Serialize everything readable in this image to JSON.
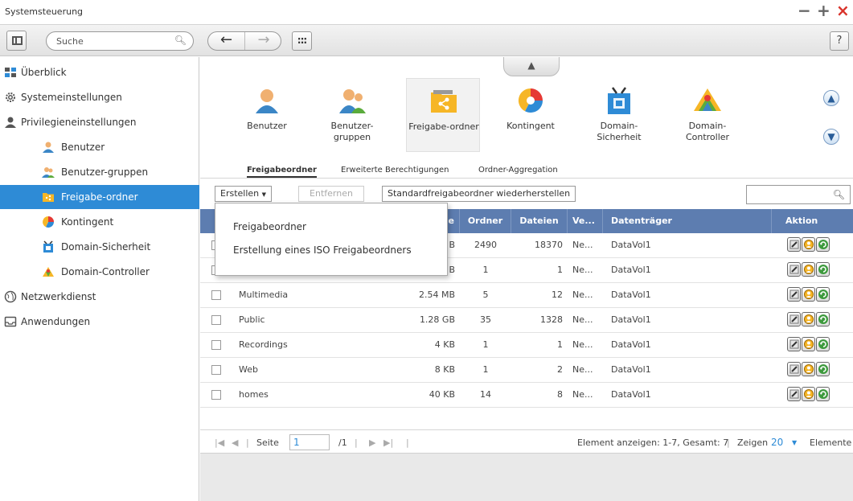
{
  "window": {
    "title": "Systemsteuerung"
  },
  "toolbar": {
    "search_placeholder": "Suche",
    "help_label": "?"
  },
  "sidebar": {
    "items": [
      {
        "label": "Überblick",
        "icon": "overview-icon"
      },
      {
        "label": "Systemeinstellungen",
        "icon": "gear-icon"
      },
      {
        "label": "Privilegieneinstellungen",
        "icon": "user-icon"
      },
      {
        "label": "Benutzer",
        "icon": "user-icon"
      },
      {
        "label": "Benutzer-gruppen",
        "icon": "users-icon"
      },
      {
        "label": "Freigabe-ordner",
        "icon": "shared-folder-icon",
        "active": true
      },
      {
        "label": "Kontingent",
        "icon": "quota-icon"
      },
      {
        "label": "Domain-Sicherheit",
        "icon": "domain-security-icon"
      },
      {
        "label": "Domain-Controller",
        "icon": "domain-controller-icon"
      },
      {
        "label": "Netzwerkdienst",
        "icon": "globe-icon"
      },
      {
        "label": "Anwendungen",
        "icon": "applications-icon"
      }
    ]
  },
  "apps": [
    {
      "label": "Benutzer"
    },
    {
      "label": "Benutzer-gruppen"
    },
    {
      "label": "Freigabe-ordner"
    },
    {
      "label": "Kontingent"
    },
    {
      "label": "Domain-Sicherheit"
    },
    {
      "label": "Domain-Controller"
    }
  ],
  "tabs": [
    "Freigabeordner",
    "Erweiterte Berechtigungen",
    "Ordner-Aggregation"
  ],
  "actions": {
    "create": "Erstellen",
    "remove": "Entfernen",
    "restore": "Standardfreigabeordner wiederherstellen"
  },
  "dropdown": {
    "items": [
      "Freigabeordner",
      "Erstellung eines ISO Freigabeordners"
    ]
  },
  "table": {
    "columns": [
      "e",
      "Ordner",
      "Dateien",
      "Ve...",
      "Datenträger",
      "Aktion"
    ],
    "rows": [
      {
        "name": "",
        "size": "B",
        "folders": "2490",
        "files": "18370",
        "ve": "Ne...",
        "volume": "DataVol1"
      },
      {
        "name": "",
        "size": "B",
        "folders": "1",
        "files": "1",
        "ve": "Ne...",
        "volume": "DataVol1"
      },
      {
        "name": "Multimedia",
        "size": "2.54 MB",
        "folders": "5",
        "files": "12",
        "ve": "Ne...",
        "volume": "DataVol1"
      },
      {
        "name": "Public",
        "size": "1.28 GB",
        "folders": "35",
        "files": "1328",
        "ve": "Ne...",
        "volume": "DataVol1"
      },
      {
        "name": "Recordings",
        "size": "4 KB",
        "folders": "1",
        "files": "1",
        "ve": "Ne...",
        "volume": "DataVol1"
      },
      {
        "name": "Web",
        "size": "8 KB",
        "folders": "1",
        "files": "2",
        "ve": "Ne...",
        "volume": "DataVol1"
      },
      {
        "name": "homes",
        "size": "40 KB",
        "folders": "14",
        "files": "8",
        "ve": "Ne...",
        "volume": "DataVol1"
      }
    ]
  },
  "pager": {
    "page_label": "Seite",
    "page_value": "1",
    "total_pages": "/1",
    "summary": "Element anzeigen: 1-7, Gesamt: 7",
    "show_label": "Zeigen",
    "per_page": "20",
    "items_label": "Elemente"
  },
  "colors": {
    "accent": "#2e8bd6",
    "table_header": "#5d7db0",
    "close": "#d9332b"
  }
}
